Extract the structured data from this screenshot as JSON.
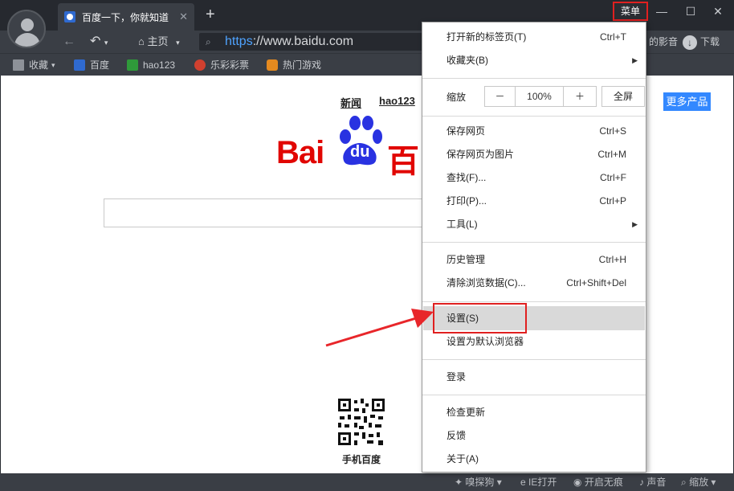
{
  "tab": {
    "title": "百度一下，你就知道",
    "close": "✕"
  },
  "titlebar": {
    "new_tab": "+",
    "menu_label": "菜单",
    "minimize": "—",
    "maximize": "☐",
    "close": "✕"
  },
  "toolbar": {
    "home_label": "主页",
    "url_scheme": "https",
    "url_rest": "://www.baidu.com",
    "right_text": "的影音",
    "download_label": "下载"
  },
  "bookmarks": [
    {
      "label": "收藏",
      "icon": "star-icon"
    },
    {
      "label": "百度",
      "icon": "baidu-paw-icon"
    },
    {
      "label": "hao123",
      "icon": "hao123-icon"
    },
    {
      "label": "乐彩彩票",
      "icon": "lottery-icon"
    },
    {
      "label": "热门游戏",
      "icon": "game-icon"
    }
  ],
  "page": {
    "links": [
      "新闻",
      "hao123"
    ],
    "more_products": "更多产品",
    "logo_left": "Bai",
    "logo_du": "du",
    "logo_right": "百",
    "qr_label": "手机百度"
  },
  "menu": {
    "items_group1": [
      {
        "label": "打开新的标签页(T)",
        "shortcut": "Ctrl+T"
      },
      {
        "label": "收藏夹(B)",
        "shortcut": "",
        "submenu": "▶"
      }
    ],
    "zoom": {
      "label": "缩放",
      "minus": "－",
      "value": "100%",
      "plus": "＋",
      "fullscreen": "全屏"
    },
    "items_group2": [
      {
        "label": "保存网页",
        "shortcut": "Ctrl+S"
      },
      {
        "label": "保存网页为图片",
        "shortcut": "Ctrl+M"
      },
      {
        "label": "查找(F)...",
        "shortcut": "Ctrl+F"
      },
      {
        "label": "打印(P)...",
        "shortcut": "Ctrl+P"
      },
      {
        "label": "工具(L)",
        "shortcut": "",
        "submenu": "▶"
      }
    ],
    "items_group3": [
      {
        "label": "历史管理",
        "shortcut": "Ctrl+H"
      },
      {
        "label": "清除浏览数据(C)...",
        "shortcut": "Ctrl+Shift+Del"
      }
    ],
    "items_group4": [
      {
        "label": "设置(S)",
        "shortcut": ""
      },
      {
        "label": "设置为默认浏览器",
        "shortcut": ""
      }
    ],
    "items_group5": [
      {
        "label": "登录",
        "shortcut": ""
      }
    ],
    "items_group6": [
      {
        "label": "检查更新",
        "shortcut": ""
      },
      {
        "label": "反馈",
        "shortcut": ""
      },
      {
        "label": "关于(A)",
        "shortcut": ""
      }
    ]
  },
  "statusbar": {
    "items": [
      "嗅探狗 ▾",
      "IE打开",
      "开启无痕",
      "声音",
      "缩放 ▾"
    ]
  },
  "colors": {
    "highlight_box": "#e02020",
    "baidu_red": "#e10602",
    "baidu_blue": "#2932e1",
    "more_button": "#3388ff"
  }
}
